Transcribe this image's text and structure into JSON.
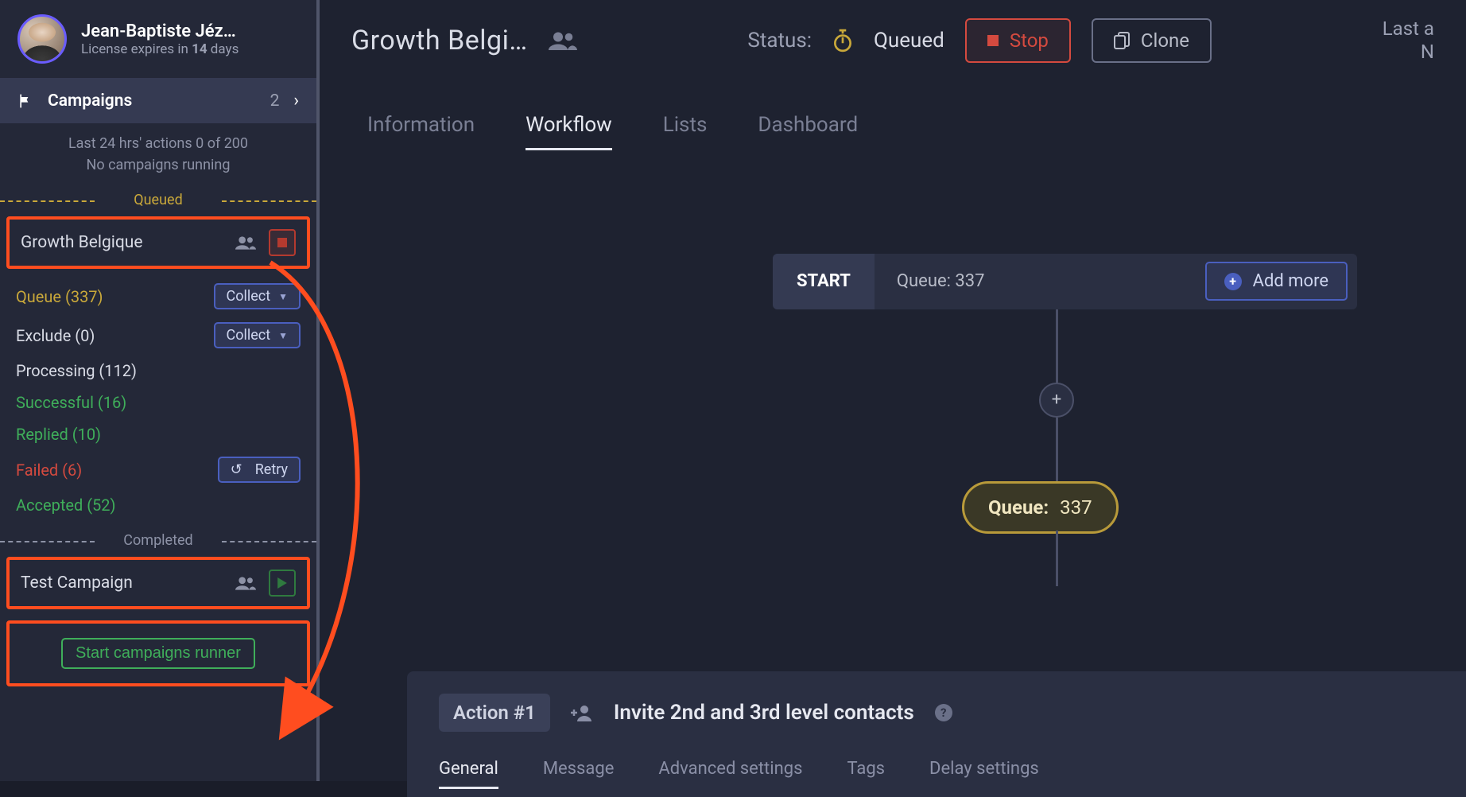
{
  "profile": {
    "name": "Jean-Baptiste Jéz…",
    "license_prefix": "License expires in ",
    "license_days": "14",
    "license_suffix": " days"
  },
  "nav": {
    "campaigns_label": "Campaigns",
    "campaigns_count": "2"
  },
  "status_block": {
    "line1": "Last 24 hrs' actions 0 of 200",
    "line2": "No campaigns running"
  },
  "dividers": {
    "queued": "Queued",
    "completed": "Completed"
  },
  "campaign_active": {
    "name": "Growth Belgique"
  },
  "stats": {
    "queue": "Queue (337)",
    "exclude": "Exclude (0)",
    "processing": "Processing (112)",
    "successful": "Successful (16)",
    "replied": "Replied (10)",
    "failed": "Failed (6)",
    "accepted": "Accepted (52)",
    "collect_btn": "Collect",
    "retry_btn": "Retry"
  },
  "campaign_completed": {
    "name": "Test Campaign"
  },
  "runner_btn": "Start campaigns runner",
  "header": {
    "title": "Growth Belgi…",
    "status_label": "Status:",
    "status_value": "Queued",
    "stop": "Stop",
    "clone": "Clone",
    "last": "Last a",
    "last2": "N"
  },
  "tabs": {
    "information": "Information",
    "workflow": "Workflow",
    "lists": "Lists",
    "dashboard": "Dashboard"
  },
  "workflow": {
    "start": "START",
    "queue_label": "Queue: 337",
    "add_more": "Add more",
    "queue_node_label": "Queue:",
    "queue_node_value": "337"
  },
  "action": {
    "badge": "Action #1",
    "title": "Invite 2nd and 3rd level contacts",
    "tabs": {
      "general": "General",
      "message": "Message",
      "advanced": "Advanced settings",
      "tags": "Tags",
      "delay": "Delay settings"
    }
  }
}
